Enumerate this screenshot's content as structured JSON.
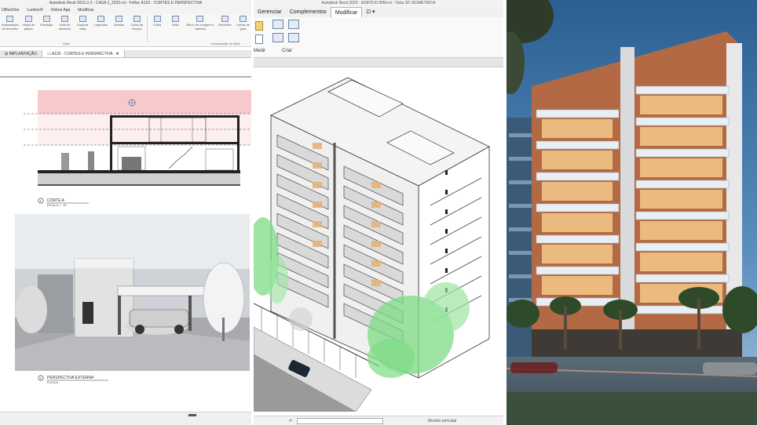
{
  "left_window": {
    "title": "Autodesk Revit 2019.2.3 - CASA 2_2023.rvt - Folha: A102 - CORTES E PERSPECTIVA",
    "menu": [
      "OfficeOne",
      "Lumion®",
      "Onbox App",
      "Modificar"
    ],
    "ribbon_buttons": [
      "Implantação do desenho",
      "Vistas de planta",
      "Elevação",
      "Vista de desenho",
      "Duplicar vista",
      "Legendas",
      "Tabelas",
      "Caixa de escopo",
      "Folha",
      "Vista",
      "Bloco de margem e carimbo",
      "Revisões",
      "Linhas de guia"
    ],
    "group_create": "Criar",
    "group_compose": "Composição de folha",
    "tabs": [
      {
        "label": "IMPLANTAÇÃO",
        "active": false
      },
      {
        "label": "A102 - CORTES E PERSPECTIVA",
        "active": true
      }
    ],
    "tab_close": "✕",
    "section_view": {
      "number": "1",
      "title": "CORTE A",
      "scale": "ESCALA: 1 : 50"
    },
    "perspective_view": {
      "number": "3",
      "title": "PERSPECTIVA EXTERNA",
      "scale": "ESCALA"
    }
  },
  "middle_window": {
    "title": "Autodesk Revit 2023 - EDIFÍCIO BIM.rvt - Vista 3D ISOMÉTRICA",
    "menu": [
      {
        "label": "Gerenciar",
        "active": false
      },
      {
        "label": "Complementos",
        "active": false
      },
      {
        "label": "Modificar",
        "active": true
      },
      {
        "label": "⊡ ▾",
        "active": false
      }
    ],
    "ribbon_labels": {
      "measure": "Medir",
      "create": "Criar"
    },
    "status": "Modelo principal"
  },
  "colors": {
    "section_highlight": "#f7c9cc",
    "glass_green": "#7ddc86",
    "balcony_wood": "#e6b27c",
    "brick_facade": "#b36a44",
    "sky_top": "#2b5f91"
  }
}
